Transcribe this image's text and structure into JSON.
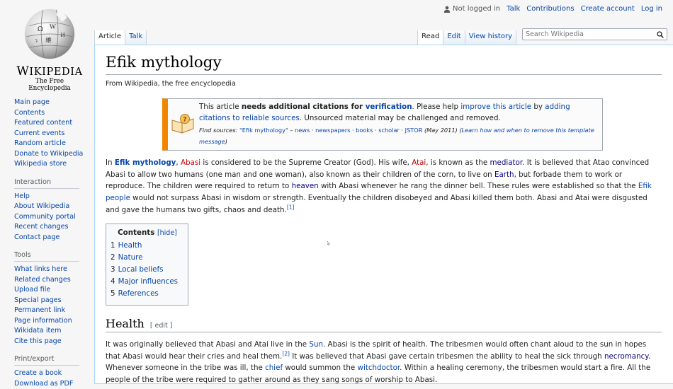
{
  "personal": {
    "not_logged_in": "Not logged in",
    "talk": "Talk",
    "contributions": "Contributions",
    "create_account": "Create account",
    "log_in": "Log in"
  },
  "logo": {
    "wordmark_cap": "W",
    "wordmark_rest": "IKIPEDIA",
    "wordmark_cap2": "A",
    "tagline": "The Free Encyclopedia"
  },
  "sidebar": {
    "nav": [
      "Main page",
      "Contents",
      "Featured content",
      "Current events",
      "Random article",
      "Donate to Wikipedia",
      "Wikipedia store"
    ],
    "interaction_heading": "Interaction",
    "interaction": [
      "Help",
      "About Wikipedia",
      "Community portal",
      "Recent changes",
      "Contact page"
    ],
    "tools_heading": "Tools",
    "tools": [
      "What links here",
      "Related changes",
      "Upload file",
      "Special pages",
      "Permanent link",
      "Page information",
      "Wikidata item",
      "Cite this page"
    ],
    "print_heading": "Print/export",
    "print": [
      "Create a book",
      "Download as PDF"
    ]
  },
  "tabs": {
    "article": "Article",
    "talk": "Talk",
    "read": "Read",
    "edit": "Edit",
    "history": "View history"
  },
  "search": {
    "placeholder": "Search Wikipedia"
  },
  "page": {
    "title": "Efik mythology",
    "sitesub": "From Wikipedia, the free encyclopedia"
  },
  "ambox": {
    "t1": "This article ",
    "t2": "needs additional citations for ",
    "t3": "verification",
    "t4": ". Please help ",
    "t5": "improve this article",
    "t6": " by ",
    "t7": "adding citations to reliable sources",
    "t8": ". Unsourced material may be challenged and removed.",
    "find": "Find sources: ",
    "q": "\"Efik mythology\"",
    "dash": " – ",
    "news": "news",
    "dot": " · ",
    "newspapers": "newspapers",
    "books": "books",
    "scholar": "scholar",
    "jstor": "JSTOR",
    "date": " (May 2011)",
    "learn": "Learn how and when to remove this template message"
  },
  "intro": {
    "s1": "In ",
    "efik_myth": "Efik mythology",
    "s2": ", ",
    "abasi": "Abasi",
    "s3": " is considered to be the Supreme Creator (God). His wife, ",
    "atai": "Atai",
    "s4": ", is known as the ",
    "mediator": "mediator",
    "s5": ". It is believed that Atao convinced Abasi to allow two humans (one man and one woman), also known as their children of the corn, to live on ",
    "earth": "Earth",
    "s6": ", but forbade them to work or reproduce. The children were required to return to ",
    "heaven": "heaven",
    "s7": " with Abasi whenever he rang the dinner bell. These rules were established so that the ",
    "efik_people": "Efik people",
    "s8": " would not surpass Abasi in wisdom or strength. Eventually the children disobeyed and Abasi killed them both. Abasi and Atai were disgusted and gave the humans two gifts, chaos and death.",
    "ref1": "[1]"
  },
  "toc": {
    "title": "Contents",
    "toggle": "[hide]",
    "items": [
      {
        "num": "1",
        "label": "Health"
      },
      {
        "num": "2",
        "label": "Nature"
      },
      {
        "num": "3",
        "label": "Local beliefs"
      },
      {
        "num": "4",
        "label": "Major influences"
      },
      {
        "num": "5",
        "label": "References"
      }
    ]
  },
  "health": {
    "heading": "Health",
    "edit": "[ edit ]",
    "s1": "It was originally believed that Abasi and Atai live in the ",
    "sun": "Sun",
    "s2": ". Abasi is the spirit of health. The tribesmen would often chant aloud to the sun in hopes that Abasi would hear their cries and heal them.",
    "ref2": "[2]",
    "s3": " It was believed that Abasi gave certain tribesmen the ability to heal the sick through ",
    "necromancy": "necromancy",
    "s4": ". Whenever someone in the tribe was ill, the ",
    "chief": "chief",
    "s5": " would summon the ",
    "witchdoctor": "witchdoctor",
    "s6": ". Within a healing ceremony, the tribesmen would start a fire. All the people of the tribe were required to gather around as they sang songs of worship to Abasi."
  }
}
